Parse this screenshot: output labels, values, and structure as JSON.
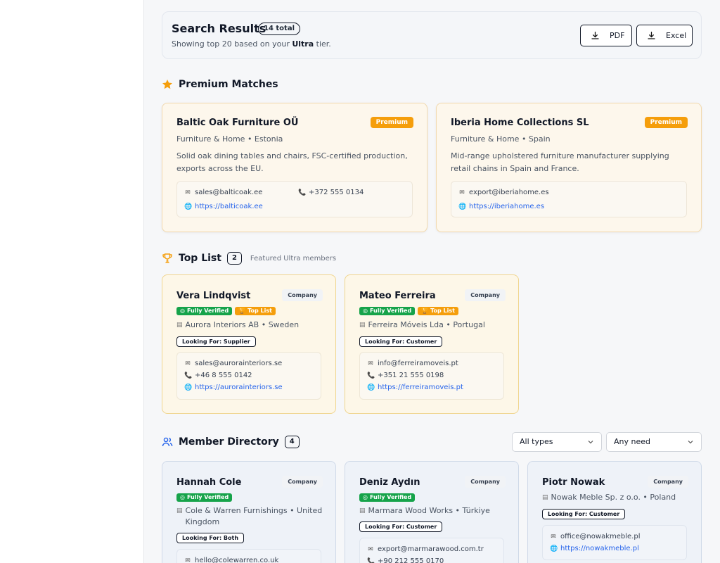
{
  "header": {
    "title": "Search Results",
    "count": "14 total",
    "subtitle_prefix": "Showing top 20 based on your ",
    "subtitle_tier": "Ultra",
    "subtitle_suffix": " tier.",
    "pdf_label": "PDF",
    "excel_label": "Excel"
  },
  "premium": {
    "title": "Premium Matches",
    "cards": [
      {
        "name": "Baltic Oak Furniture OÜ",
        "badge": "Premium",
        "meta": "Furniture & Home • Estonia",
        "desc": "Solid oak dining tables and chairs, FSC-certified production, exports across the EU.",
        "email": "sales@balticoak.ee",
        "phone": "+372 555 0134",
        "website": "https://balticoak.ee"
      },
      {
        "name": "Iberia Home Collections SL",
        "badge": "Premium",
        "meta": "Furniture & Home • Spain",
        "desc": "Mid-range upholstered furniture manufacturer supplying retail chains in Spain and France.",
        "email": "export@iberiahome.es",
        "website": "https://iberiahome.es"
      }
    ]
  },
  "toplist": {
    "title": "Top List",
    "count": "2",
    "note": "Featured Ultra members",
    "cards": [
      {
        "name": "Vera Lindqvist",
        "type": "Company",
        "verified": "Fully Verified",
        "toplist": "Top List",
        "org": "Aurora Interiors AB • Sweden",
        "looking": "Looking For: Supplier",
        "email": "sales@aurorainteriors.se",
        "phone": "+46 8 555 0142",
        "website": "https://aurorainteriors.se"
      },
      {
        "name": "Mateo Ferreira",
        "type": "Company",
        "verified": "Fully Verified",
        "toplist": "Top List",
        "org": "Ferreira Móveis Lda • Portugal",
        "looking": "Looking For: Customer",
        "email": "info@ferreiramoveis.pt",
        "phone": "+351 21 555 0198",
        "website": "https://ferreiramoveis.pt"
      }
    ]
  },
  "directory": {
    "title": "Member Directory",
    "count": "4",
    "type_filter": "All types",
    "need_filter": "Any need",
    "cards": [
      {
        "name": "Hannah Cole",
        "type": "Company",
        "verified": "Fully Verified",
        "org": "Cole & Warren Furnishings • United Kingdom",
        "looking": "Looking For: Both",
        "email": "hello@colewarren.co.uk"
      },
      {
        "name": "Deniz Aydın",
        "type": "Company",
        "verified": "Fully Verified",
        "org": "Marmara Wood Works • Türkiye",
        "looking": "Looking For: Customer",
        "email": "export@marmarawood.com.tr",
        "phone": "+90 212 555 0170"
      },
      {
        "name": "Piotr Nowak",
        "type": "Company",
        "org": "Nowak Meble Sp. z o.o. • Poland",
        "looking": "Looking For: Customer",
        "email": "office@nowakmeble.pl",
        "website": "https://nowakmeble.pl"
      }
    ]
  }
}
